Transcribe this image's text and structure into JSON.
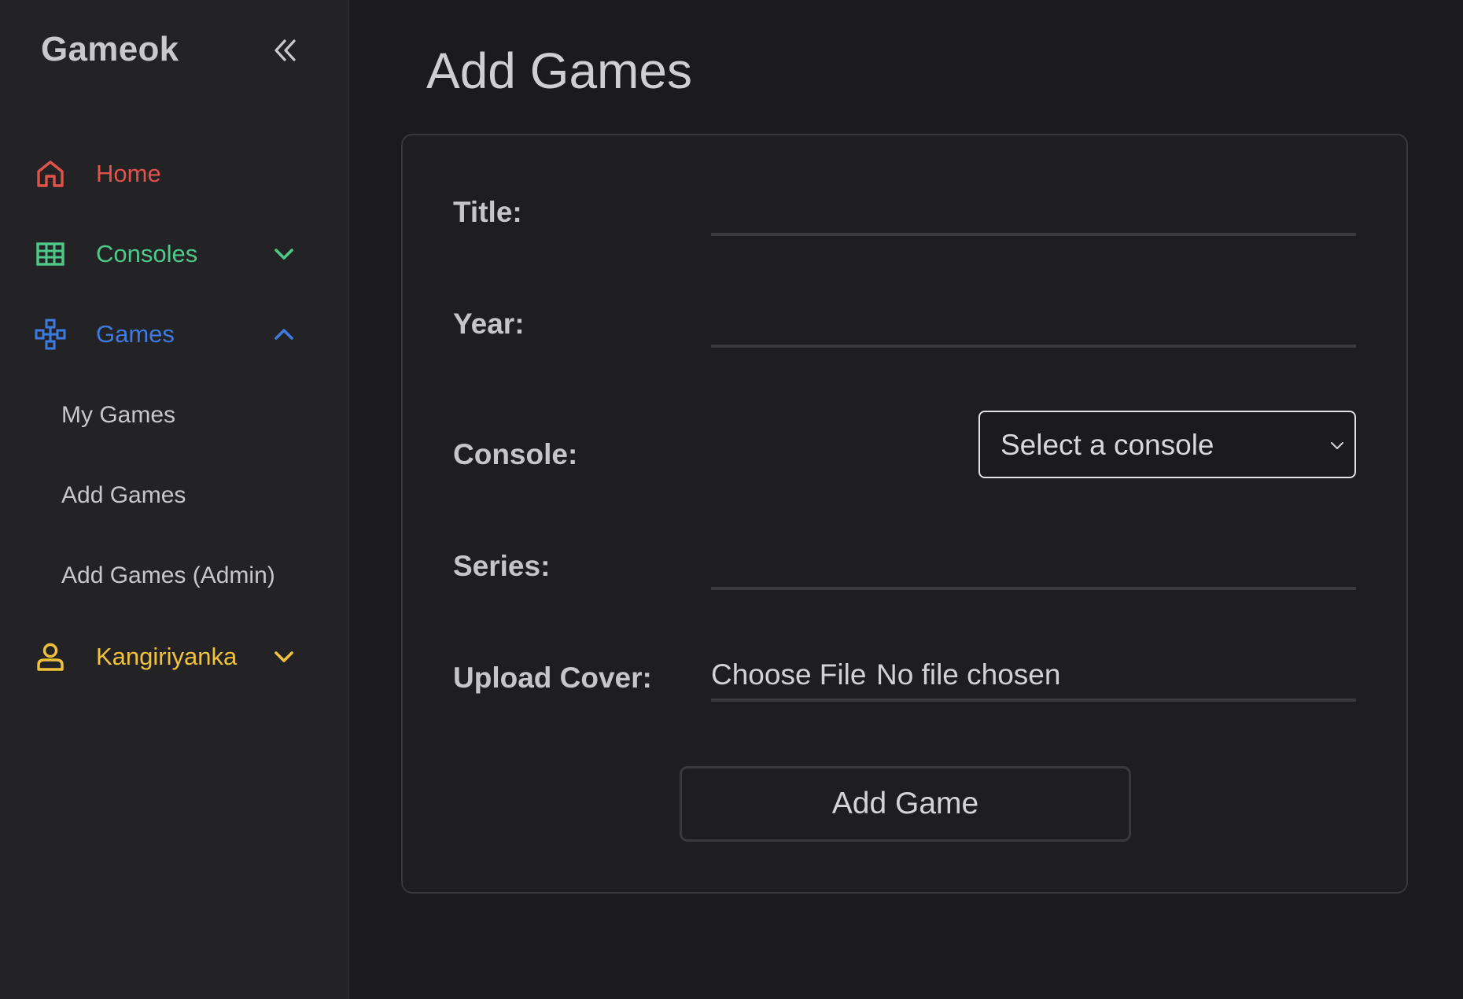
{
  "sidebar": {
    "brand": "Gameok",
    "collapse_icon": "double-chevron-left-icon",
    "items": [
      {
        "label": "Home",
        "icon": "home-icon",
        "color": "#e0524a"
      },
      {
        "label": "Consoles",
        "icon": "grid-icon",
        "color": "#4fc98a",
        "expanded": false
      },
      {
        "label": "Games",
        "icon": "gamepad-icon",
        "color": "#3d7be0",
        "expanded": true,
        "children": [
          "My Games",
          "Add Games",
          "Add Games (Admin)"
        ]
      },
      {
        "label": "Kangiriyanka",
        "icon": "user-icon",
        "color": "#f2c23d",
        "expanded": false
      }
    ]
  },
  "main": {
    "title": "Add Games",
    "form": {
      "title_label": "Title:",
      "title_value": "",
      "year_label": "Year:",
      "year_value": "",
      "console_label": "Console:",
      "console_selected": "Select a console",
      "series_label": "Series:",
      "series_value": "",
      "cover_label": "Upload Cover:",
      "file_button": "Choose File",
      "file_status": "No file chosen",
      "submit_label": "Add Game"
    }
  }
}
